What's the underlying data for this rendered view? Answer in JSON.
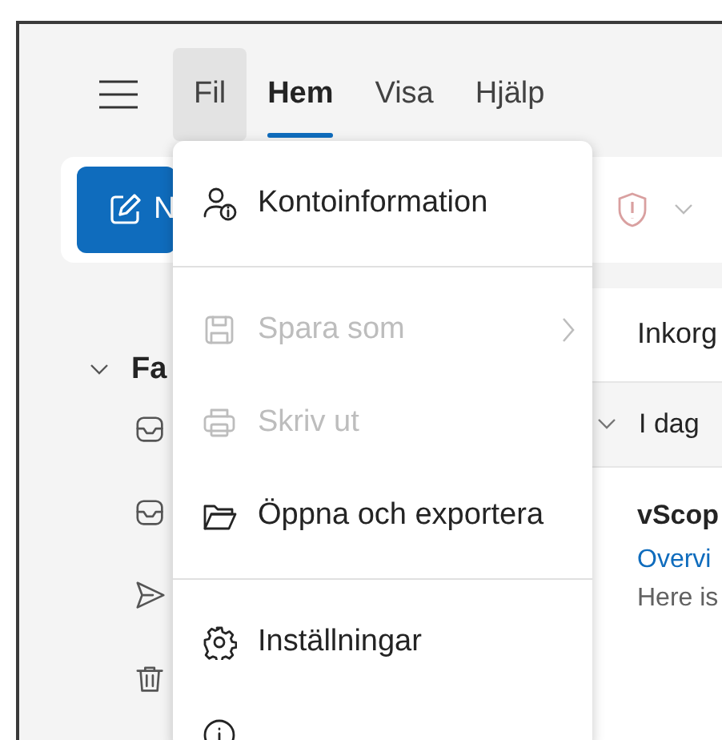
{
  "menu_bar": [
    {
      "label": "Fil",
      "open": true,
      "selected": false
    },
    {
      "label": "Hem",
      "open": false,
      "selected": true
    },
    {
      "label": "Visa",
      "open": false,
      "selected": false
    },
    {
      "label": "Hjälp",
      "open": false,
      "selected": false
    }
  ],
  "toolbar": {
    "new_button": "N"
  },
  "sidebar": {
    "section": {
      "label": "Fa",
      "expanded": true
    },
    "folders": [
      {
        "kind": "inbox"
      },
      {
        "kind": "inbox"
      },
      {
        "kind": "sent"
      },
      {
        "kind": "trash"
      }
    ]
  },
  "mail_list": {
    "title": "Inkorg",
    "group": {
      "label": "I dag",
      "expanded": true
    },
    "messages": [
      {
        "sender": "vScop",
        "subject": "Overvi",
        "preview": "Here is",
        "unread": true
      }
    ]
  },
  "file_menu": {
    "items": [
      {
        "kind": "item",
        "label": "Kontoinformation",
        "disabled": false,
        "submenu": false
      },
      {
        "kind": "divider"
      },
      {
        "kind": "item",
        "label": "Spara som",
        "disabled": true,
        "submenu": true
      },
      {
        "kind": "item",
        "label": "Skriv ut",
        "disabled": true,
        "submenu": false
      },
      {
        "kind": "item",
        "label": "Öppna och exportera",
        "disabled": false,
        "submenu": false
      },
      {
        "kind": "divider"
      },
      {
        "kind": "item",
        "label": "Inställningar",
        "disabled": false,
        "submenu": false
      },
      {
        "kind": "item",
        "disabled": false
      }
    ]
  }
}
